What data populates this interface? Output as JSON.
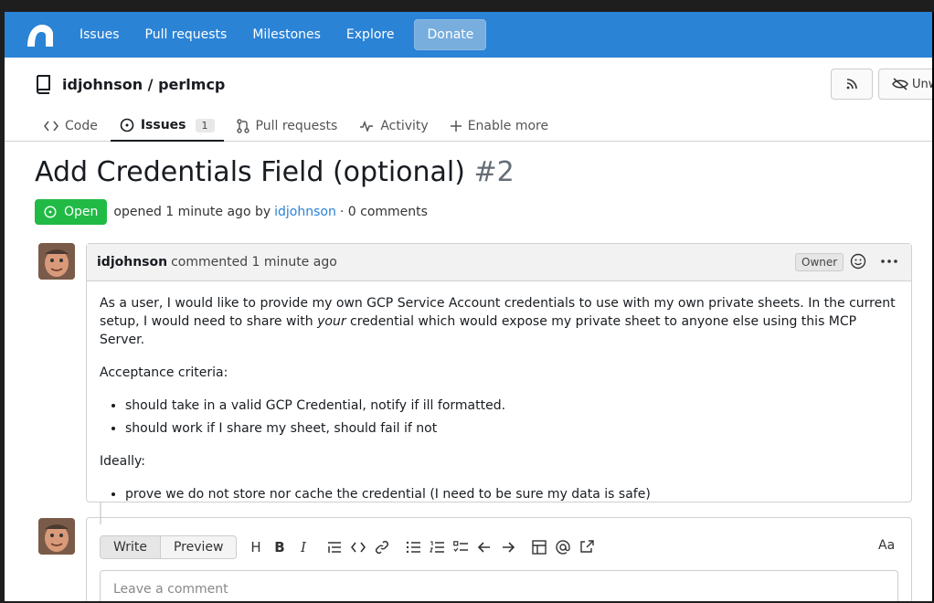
{
  "nav": {
    "items": [
      "Issues",
      "Pull requests",
      "Milestones",
      "Explore"
    ],
    "donate": "Donate"
  },
  "repo": {
    "owner_repo": "idjohnson / perlmcp",
    "unwatch_label": "Unw"
  },
  "tabs": [
    {
      "label": "Code",
      "icon": "code-icon"
    },
    {
      "label": "Issues",
      "icon": "issue-icon",
      "count": "1"
    },
    {
      "label": "Pull requests",
      "icon": "pull-request-icon"
    },
    {
      "label": "Activity",
      "icon": "pulse-icon"
    },
    {
      "label": "Enable more",
      "icon": "plus-icon"
    }
  ],
  "issue": {
    "title": "Add Credentials Field (optional)",
    "number": "#2",
    "state": "Open",
    "meta_prefix": "opened 1 minute ago by",
    "author": "idjohnson",
    "meta_suffix": "· 0 comments"
  },
  "comment": {
    "author": "idjohnson",
    "action": "commented 1 minute ago",
    "role": "Owner",
    "body": {
      "para1_a": "As a user, I would like to provide my own GCP Service Account credentials to use with my own private sheets. In the current setup, I would need to share with ",
      "para1_em": "your",
      "para1_b": " credential which would expose my private sheet to anyone else using this MCP Server.",
      "criteria_heading": "Acceptance criteria:",
      "criteria": [
        "should take in a valid GCP Credential, notify if ill formatted.",
        "should work if I share my sheet, should fail if not"
      ],
      "ideally_heading": "Ideally:",
      "ideally": [
        "prove we do not store nor cache the credential (I need to be sure my data is safe)"
      ]
    }
  },
  "editor": {
    "write_tab": "Write",
    "preview_tab": "Preview",
    "toolbar": [
      "H",
      "B",
      "I"
    ],
    "aa": "Aa",
    "placeholder": "Leave a comment"
  },
  "colors": {
    "nav_bg": "#2b83d5",
    "open_green": "#21ba45",
    "link_blue": "#2b83d5"
  }
}
